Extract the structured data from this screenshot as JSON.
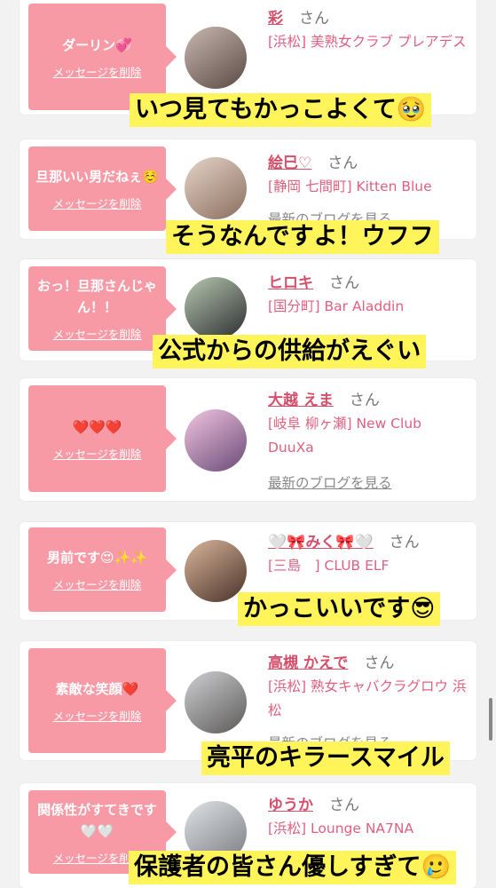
{
  "delete_label": "メッセージを削除",
  "blog_label": "最新のブログを見る",
  "san_label": "さん",
  "cards": [
    {
      "message": "ダーリン💞",
      "name": "彩",
      "shop": "[浜松] 美熟女クラブ プレアデス",
      "caption": "いつ見てもかっこよくて🥹"
    },
    {
      "message": "旦那いい男だねぇ☺️",
      "name": "絵巳♡",
      "shop": "[静岡 七間町] Kitten Blue",
      "caption": "そうなんですよ！ウフフ"
    },
    {
      "message": "おっ！旦那さんじゃん！！",
      "name": "ヒロキ",
      "shop": "[国分町] Bar Aladdin",
      "caption": "公式からの供給がえぐい"
    },
    {
      "message": "❤️❤️❤️",
      "name": "大越 えま",
      "shop": "[岐阜 柳ヶ瀬] New Club DuuXa",
      "caption": ""
    },
    {
      "message": "男前です😍✨✨",
      "name": "🤍🎀みく🎀🤍",
      "shop": "[三島　] CLUB ELF",
      "caption": "かっこいいです😎"
    },
    {
      "message": "素敵な笑顔❤️",
      "name": "高槻 かえで",
      "shop": "[浜松] 熟女キャバクラグロウ 浜松",
      "caption": "亮平のキラースマイル"
    },
    {
      "message": "関係性がすてきです🤍🤍",
      "name": "ゆうか",
      "shop": "[浜松] Lounge NA7NA",
      "caption": "保護者の皆さん優しすぎて🥲"
    }
  ]
}
